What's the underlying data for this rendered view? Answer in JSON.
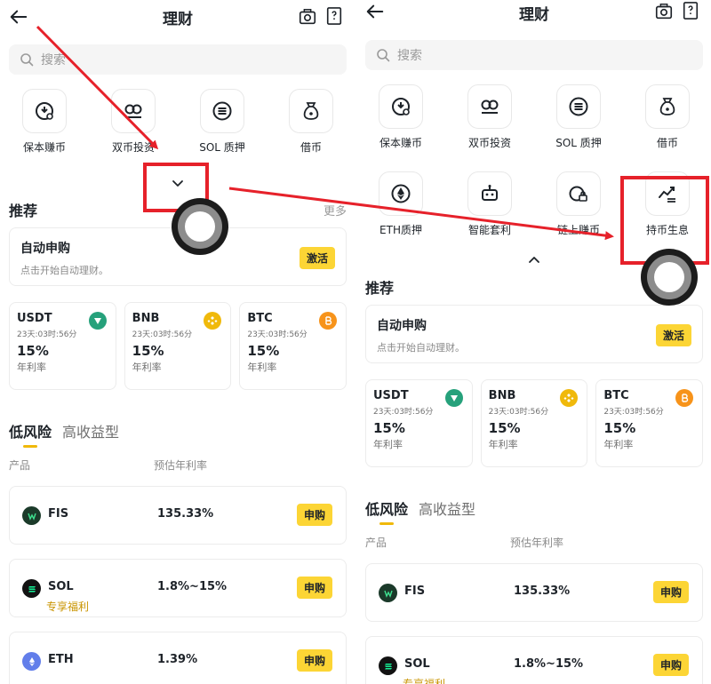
{
  "left": {
    "header": {
      "title": "理财"
    },
    "search": {
      "placeholder": "搜索"
    },
    "grid": [
      {
        "label": "保本赚币",
        "icon": "coin-shield-icon"
      },
      {
        "label": "双币投资",
        "icon": "dual-coin-icon"
      },
      {
        "label": "SOL 质押",
        "icon": "stack-coin-icon"
      },
      {
        "label": "借币",
        "icon": "money-bag-icon"
      }
    ],
    "section": {
      "title": "推荐",
      "more": "更多"
    },
    "auto": {
      "title": "自动申购",
      "subtitle": "点击开始自动理财。",
      "button": "激活"
    },
    "coins": [
      {
        "name": "USDT",
        "timer": "23天:03时:56分",
        "rate": "15%",
        "unit": "年利率",
        "icon": "usdt-icon",
        "color": "#26a17b"
      },
      {
        "name": "BNB",
        "timer": "23天:03时:56分",
        "rate": "15%",
        "unit": "年利率",
        "icon": "bnb-icon",
        "color": "#f0b90b"
      },
      {
        "name": "BTC",
        "timer": "23天:03时:56分",
        "rate": "15%",
        "unit": "年利率",
        "icon": "btc-icon",
        "color": "#f7931a"
      }
    ],
    "tabs": [
      "低风险",
      "高收益型"
    ],
    "columns": [
      "产品",
      "预估年利率"
    ],
    "products": [
      {
        "name": "FIS",
        "rate": "135.33%",
        "tag": "",
        "button": "申购",
        "icon": "fis-icon",
        "color": "#1b3a2a"
      },
      {
        "name": "SOL",
        "rate": "1.8%~15%",
        "tag": "专享福利",
        "button": "申购",
        "icon": "sol-icon",
        "color": "#121212"
      },
      {
        "name": "ETH",
        "rate": "1.39%",
        "tag": "",
        "button": "申购",
        "icon": "eth-icon",
        "color": "#627eea"
      }
    ]
  },
  "right": {
    "header": {
      "title": "理财"
    },
    "search": {
      "placeholder": "搜索"
    },
    "grid": [
      {
        "label": "保本赚币",
        "icon": "coin-shield-icon"
      },
      {
        "label": "双币投资",
        "icon": "dual-coin-icon"
      },
      {
        "label": "SOL 质押",
        "icon": "stack-coin-icon"
      },
      {
        "label": "借币",
        "icon": "money-bag-icon"
      },
      {
        "label": "ETH质押",
        "icon": "eth-stake-icon"
      },
      {
        "label": "智能套利",
        "icon": "robot-icon"
      },
      {
        "label": "链上赚币",
        "icon": "onchain-lock-icon"
      },
      {
        "label": "持币生息",
        "icon": "trend-up-icon"
      }
    ],
    "section": {
      "title": "推荐"
    },
    "auto": {
      "title": "自动申购",
      "subtitle": "点击开始自动理财。",
      "button": "激活"
    },
    "coins": [
      {
        "name": "USDT",
        "timer": "23天:03时:56分",
        "rate": "15%",
        "unit": "年利率",
        "icon": "usdt-icon",
        "color": "#26a17b"
      },
      {
        "name": "BNB",
        "timer": "23天:03时:56分",
        "rate": "15%",
        "unit": "年利率",
        "icon": "bnb-icon",
        "color": "#f0b90b"
      },
      {
        "name": "BTC",
        "timer": "23天:03时:56分",
        "rate": "15%",
        "unit": "年利率",
        "icon": "btc-icon",
        "color": "#f7931a"
      }
    ],
    "tabs": [
      "低风险",
      "高收益型"
    ],
    "columns": [
      "产品",
      "预估年利率"
    ],
    "products": [
      {
        "name": "FIS",
        "rate": "135.33%",
        "tag": "",
        "button": "申购",
        "icon": "fis-icon",
        "color": "#1b3a2a"
      },
      {
        "name": "SOL",
        "rate": "1.8%~15%",
        "tag": "专享福利",
        "button": "申购",
        "icon": "sol-icon",
        "color": "#121212"
      }
    ]
  },
  "annotation": {
    "color": "#e6212a"
  }
}
